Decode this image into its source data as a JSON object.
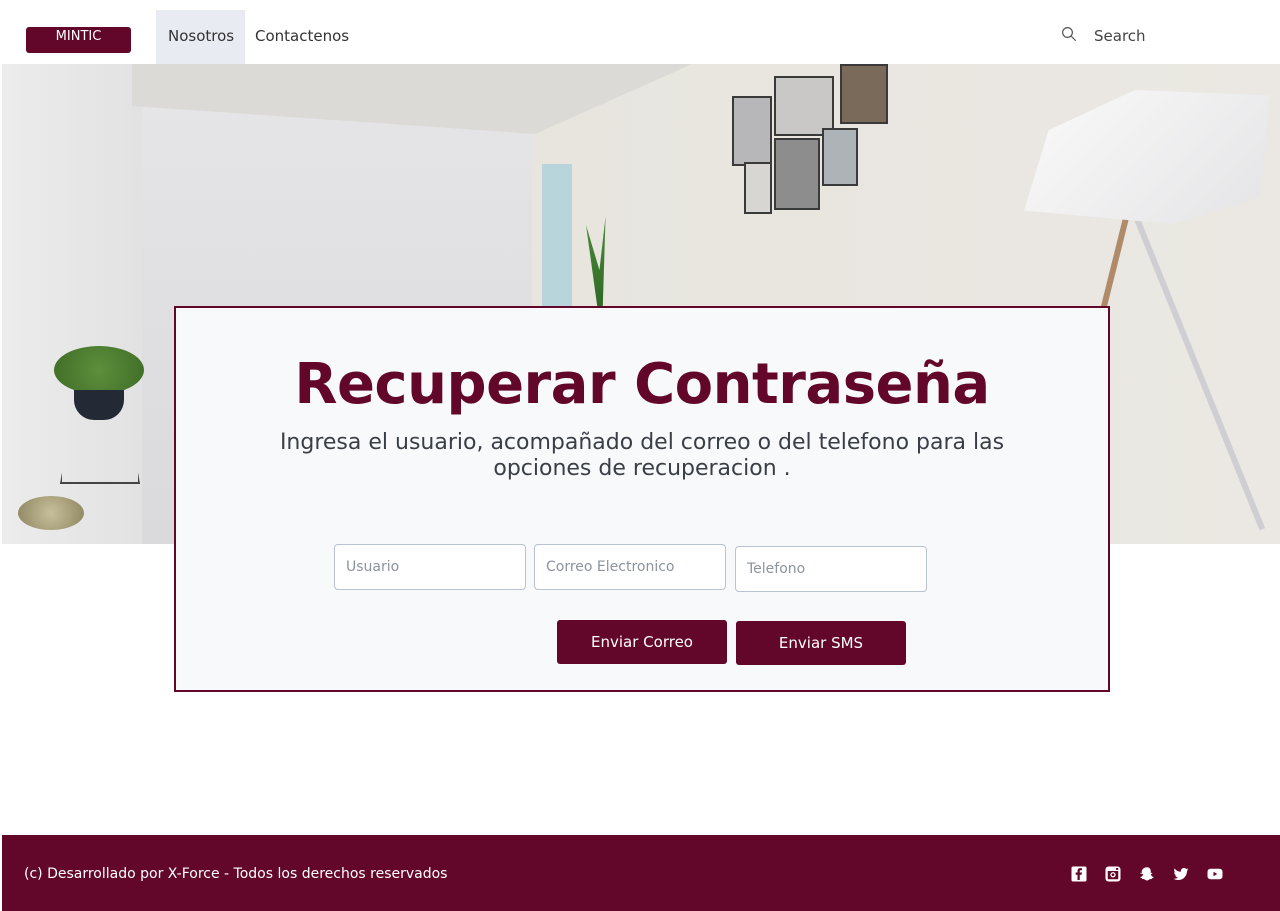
{
  "nav": {
    "brand": "MINTIC",
    "items": [
      {
        "label": "Nosotros",
        "active": true
      },
      {
        "label": "Contactenos",
        "active": false
      }
    ],
    "search_placeholder": "Search"
  },
  "card": {
    "title": "Recuperar Contraseña",
    "subtitle": "Ingresa el usuario, acompañado del correo o del telefono para las opciones de recuperacion .",
    "fields": {
      "usuario_placeholder": "Usuario",
      "correo_placeholder": "Correo Electronico",
      "telefono_placeholder": "Telefono"
    },
    "buttons": {
      "correo": "Enviar Correo",
      "sms": "Enviar SMS"
    }
  },
  "footer": {
    "copyright": "(c) Desarrollado por X-Force - Todos los derechos reservados",
    "social_icons": [
      "facebook-icon",
      "instagram-icon",
      "snapchat-icon",
      "twitter-icon",
      "youtube-icon"
    ]
  },
  "colors": {
    "brand": "#63072a",
    "nav_active_bg": "#e8ebf2",
    "card_bg": "#f8f9fa"
  }
}
